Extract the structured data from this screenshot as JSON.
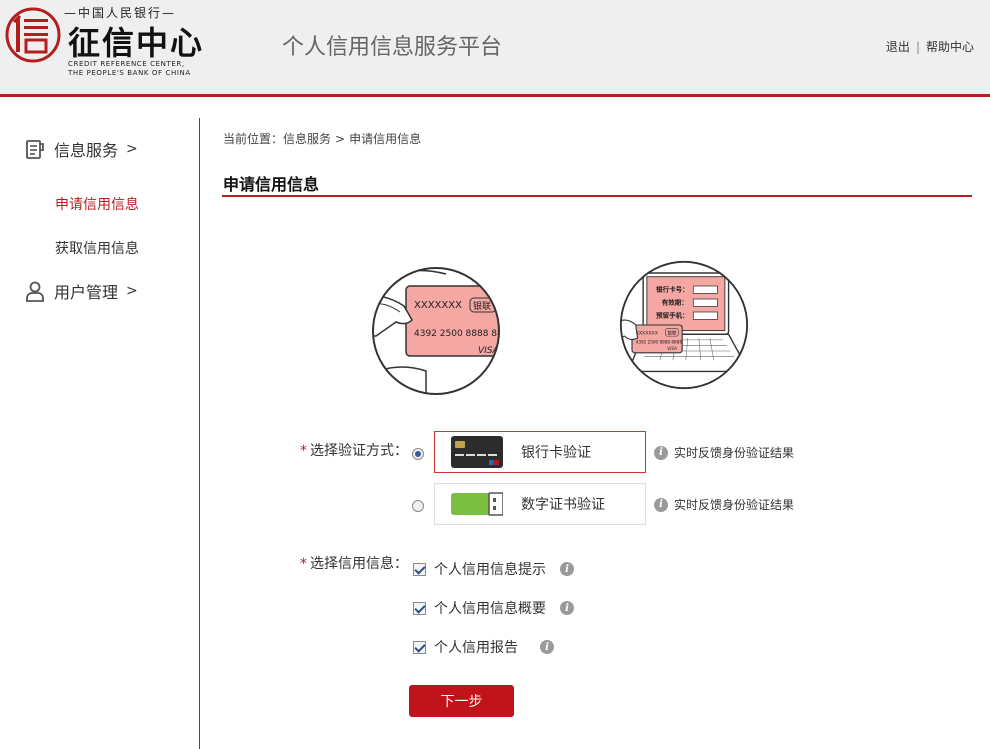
{
  "header": {
    "logo_top": "—中国人民银行—",
    "logo_main": "征信中心",
    "logo_en_line1": "CREDIT REFERENCE CENTER,",
    "logo_en_line2": "THE PEOPLE'S BANK OF CHINA",
    "platform_title": "个人信用信息服务平台",
    "links": {
      "logout": "退出",
      "separator": "|",
      "help": "帮助中心"
    }
  },
  "sidebar": {
    "groups": [
      {
        "label": "信息服务",
        "chevron": ">",
        "icon": "document-icon"
      },
      {
        "label": "用户管理",
        "chevron": ">",
        "icon": "user-icon"
      }
    ],
    "items": [
      {
        "label": "申请信用信息",
        "active": true
      },
      {
        "label": "获取信用信息",
        "active": false
      }
    ]
  },
  "breadcrumb": {
    "prefix": "当前位置：",
    "parent": "信息服务",
    "arrow": ">",
    "current": "申请信用信息"
  },
  "page_title": "申请信用信息",
  "illustrations": {
    "card": {
      "name_text": "XXXXXXX",
      "union_text": "银联",
      "number_text": "4392 2500 8888 888",
      "brand_text": "VISA"
    },
    "laptop": {
      "field1": "银行卡号：",
      "field2": "有效期：",
      "field3": "预留手机：",
      "small_card_name": "XXXXXXX",
      "small_card_union": "银联",
      "small_card_number": "4392 2500 8888 8888",
      "small_card_brand": "VISA"
    }
  },
  "form": {
    "required_mark": "*",
    "method_label": "选择验证方式：",
    "methods": [
      {
        "label": "银行卡验证",
        "checked": true,
        "icon": "bank-card-icon",
        "hint": "实时反馈身份验证结果"
      },
      {
        "label": "数字证书验证",
        "checked": false,
        "icon": "usb-key-icon",
        "hint": "实时反馈身份验证结果"
      }
    ],
    "info_label": "选择信用信息：",
    "options": [
      {
        "label": "个人信用信息提示",
        "checked": true
      },
      {
        "label": "个人信用信息概要",
        "checked": true
      },
      {
        "label": "个人信用报告",
        "checked": true
      }
    ],
    "info_icon_glyph": "i",
    "next_button": "下一步"
  },
  "colors": {
    "brand_red": "#b51e1e",
    "button_red": "#c0141a",
    "header_bg": "#efefef",
    "card_pink": "#f4a7a3",
    "usb_green": "#7cc043"
  }
}
